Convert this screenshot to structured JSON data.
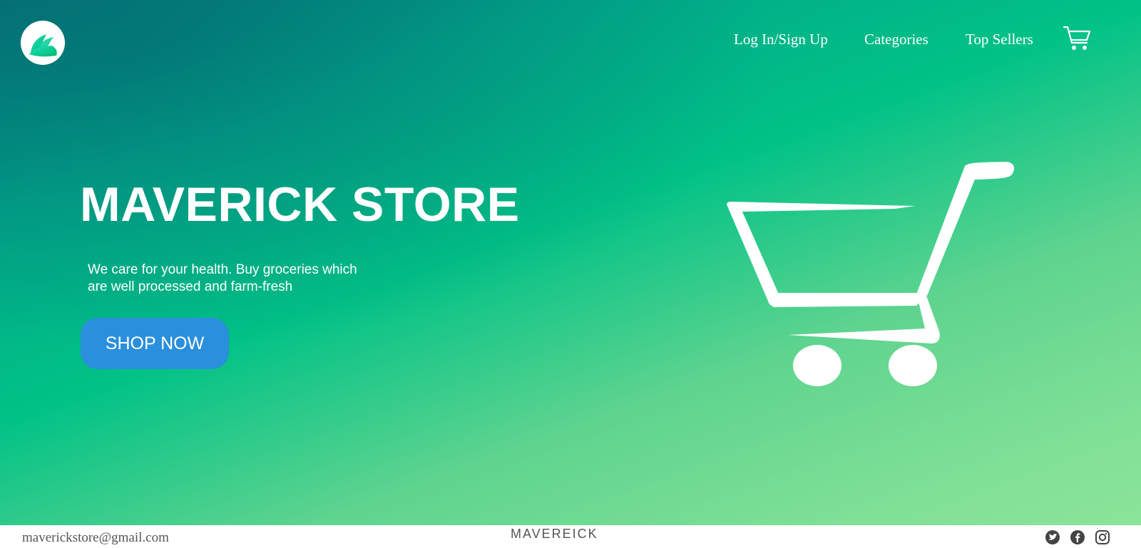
{
  "header": {
    "logo_icon": "leaf-fan-logo-icon",
    "nav": [
      {
        "label": "Log In/Sign Up"
      },
      {
        "label": "Categories"
      },
      {
        "label": "Top Sellers"
      }
    ],
    "cart_icon": "shopping-cart-icon"
  },
  "hero": {
    "title": "MAVERICK STORE",
    "tagline": "We care for your health. Buy groceries which are well processed and farm-fresh",
    "cta_label": "SHOP NOW",
    "illustration_icon": "shopping-cart-icon"
  },
  "footer": {
    "email": "maverickstore@gmail.com",
    "brand": "MAVEREICK",
    "social_icons": [
      "twitter-icon",
      "facebook-icon",
      "instagram-icon"
    ]
  },
  "colors": {
    "gradient_start": "#04787c",
    "gradient_mid": "#01c286",
    "gradient_end": "#8be49a",
    "cta_button": "#2a8fdc",
    "text_light": "#ffffff",
    "footer_text": "#555555"
  }
}
